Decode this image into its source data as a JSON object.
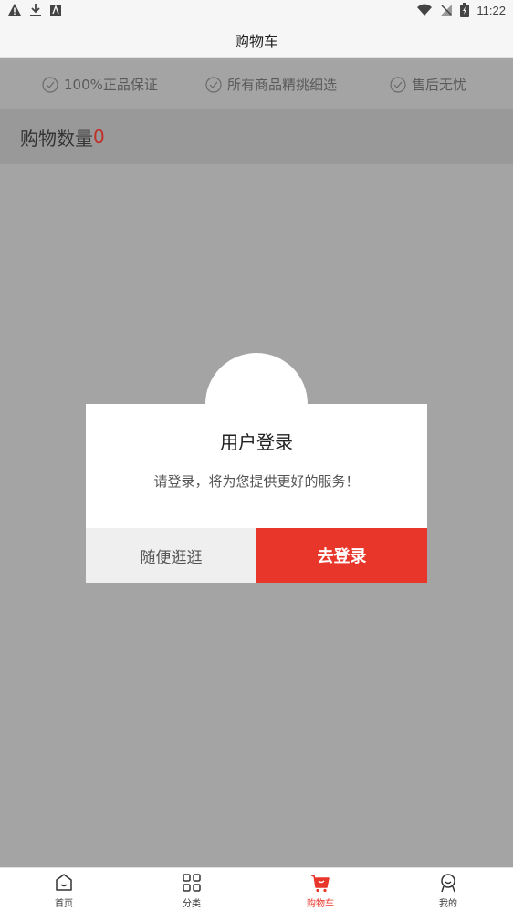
{
  "status_bar": {
    "time": "11:22"
  },
  "header": {
    "title": "购物车"
  },
  "guarantees": [
    {
      "label": "100%正品保证"
    },
    {
      "label": "所有商品精挑细选"
    },
    {
      "label": "售后无忧"
    }
  ],
  "cart": {
    "count_label": "购物数量",
    "count": "0"
  },
  "dialog": {
    "title": "用户登录",
    "message": "请登录，将为您提供更好的服务！",
    "browse_label": "随便逛逛",
    "login_label": "去登录"
  },
  "bottom_nav": [
    {
      "label": "首页",
      "icon": "home-icon"
    },
    {
      "label": "分类",
      "icon": "grid-icon"
    },
    {
      "label": "购物车",
      "icon": "cart-icon",
      "active": true
    },
    {
      "label": "我的",
      "icon": "profile-icon"
    }
  ],
  "colors": {
    "accent": "#e8362a",
    "overlay": "#a4a4a4"
  }
}
